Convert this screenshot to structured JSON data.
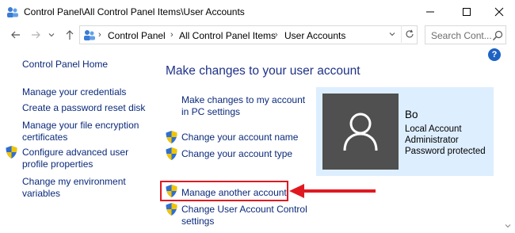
{
  "window": {
    "title": "Control Panel\\All Control Panel Items\\User Accounts",
    "app_icon": "control-panel-icon"
  },
  "address": {
    "breadcrumbs": [
      "Control Panel",
      "All Control Panel Items",
      "User Accounts"
    ],
    "search_placeholder": "Search Cont..."
  },
  "left_pane": {
    "home": "Control Panel Home",
    "links": [
      {
        "lines": [
          "Manage your credentials"
        ],
        "shield": false
      },
      {
        "lines": [
          "Create a password reset disk"
        ],
        "shield": false
      },
      {
        "lines": [
          "Manage your file encryption",
          "certificates"
        ],
        "shield": false
      },
      {
        "lines": [
          "Configure advanced user",
          "profile properties"
        ],
        "shield": true
      },
      {
        "lines": [
          "Change my environment",
          "variables"
        ],
        "shield": false
      }
    ]
  },
  "main": {
    "heading": "Make changes to your user account",
    "links": [
      {
        "lines": [
          "Make changes to my account",
          "in PC settings"
        ],
        "shield": false
      },
      {
        "lines": [
          "Change your account name"
        ],
        "shield": true
      },
      {
        "lines": [
          "Change your account type"
        ],
        "shield": true
      },
      {
        "lines": [
          "Manage another account"
        ],
        "shield": true,
        "highlighted": true
      },
      {
        "lines": [
          "Change User Account Control",
          "settings"
        ],
        "shield": true
      }
    ]
  },
  "account": {
    "name": "Bo",
    "details": [
      "Local Account",
      "Administrator",
      "Password protected"
    ]
  },
  "colors": {
    "link": "#0b2a7a",
    "heading": "#1e3287",
    "highlight": "#e01921",
    "card_bg": "#ddeeff",
    "avatar_bg": "#505050"
  }
}
